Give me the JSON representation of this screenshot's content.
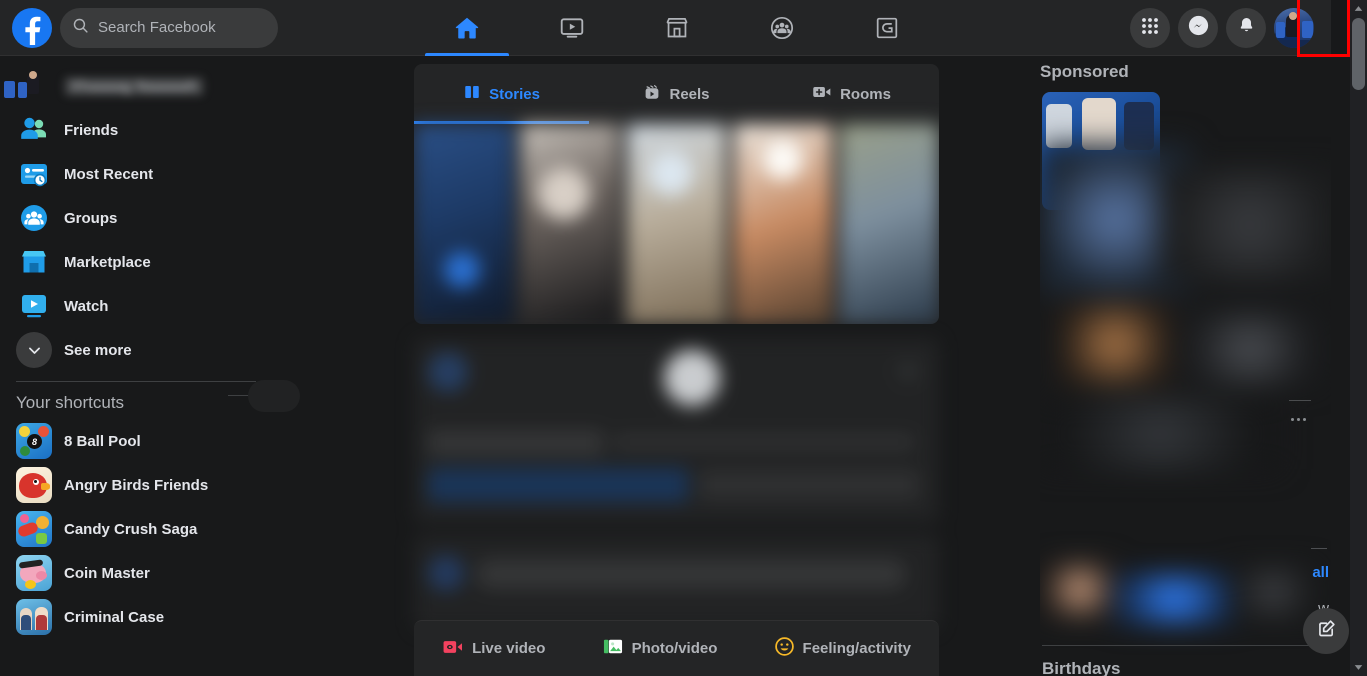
{
  "header": {
    "logo_icon": "facebook-logo",
    "search": {
      "placeholder": "Search Facebook",
      "value": "",
      "icon": "search-icon"
    },
    "nav_tabs": [
      {
        "name": "home",
        "icon": "home-icon",
        "active": true
      },
      {
        "name": "watch",
        "icon": "video-play-icon",
        "active": false
      },
      {
        "name": "marketplace",
        "icon": "storefront-icon",
        "active": false
      },
      {
        "name": "groups",
        "icon": "groups-circle-icon",
        "active": false
      },
      {
        "name": "gaming",
        "icon": "gaming-icon",
        "active": false
      }
    ],
    "actions": [
      {
        "name": "menu",
        "icon": "grid-menu-icon"
      },
      {
        "name": "messenger",
        "icon": "messenger-icon"
      },
      {
        "name": "notifications",
        "icon": "bell-icon"
      }
    ],
    "profile": {
      "name": "account-avatar",
      "icon": "avatar"
    }
  },
  "annotation": {
    "color": "#ff0000",
    "target": "profile-avatar"
  },
  "sidebar": {
    "profile_name": "",
    "items": [
      {
        "label": "Friends",
        "icon": "friends-icon"
      },
      {
        "label": "Most Recent",
        "icon": "most-recent-icon"
      },
      {
        "label": "Groups",
        "icon": "groups-icon"
      },
      {
        "label": "Marketplace",
        "icon": "marketplace-icon"
      },
      {
        "label": "Watch",
        "icon": "watch-icon"
      },
      {
        "label": "See more",
        "icon": "chevron-down-icon"
      }
    ],
    "shortcuts_heading": "Your shortcuts",
    "shortcuts": [
      {
        "label": "8 Ball Pool",
        "icon": "8-ball-pool-icon"
      },
      {
        "label": "Angry Birds Friends",
        "icon": "angry-birds-icon"
      },
      {
        "label": "Candy Crush Saga",
        "icon": "candy-crush-icon"
      },
      {
        "label": "Coin Master",
        "icon": "coin-master-icon"
      },
      {
        "label": "Criminal Case",
        "icon": "criminal-case-icon"
      }
    ]
  },
  "feed": {
    "tabs": [
      {
        "label": "Stories",
        "icon": "stories-icon",
        "active": true
      },
      {
        "label": "Reels",
        "icon": "reels-icon",
        "active": false
      },
      {
        "label": "Rooms",
        "icon": "rooms-video-icon",
        "active": false
      }
    ],
    "composer": [
      {
        "label": "Live video",
        "icon": "live-video-icon",
        "color": "#f3425f"
      },
      {
        "label": "Photo/video",
        "icon": "photo-video-icon",
        "color": "#45bd62"
      },
      {
        "label": "Feeling/activity",
        "icon": "feeling-activity-icon",
        "color": "#f7b928"
      }
    ]
  },
  "right": {
    "sponsored_heading": "Sponsored",
    "birthdays_heading": "Birthdays",
    "see_all_label": "all",
    "partial_label": "w",
    "create_button": "create-post-icon"
  },
  "scrollbar": {
    "up_icon": "scroll-up-arrow",
    "down_icon": "scroll-down-arrow"
  },
  "colors": {
    "brand_blue": "#1877f2",
    "accent_blue": "#2d88ff",
    "surface": "#242526",
    "background": "#18191a",
    "text_primary": "#e4e6eb",
    "text_secondary": "#b0b3b8",
    "annotation_red": "#ff0000"
  }
}
